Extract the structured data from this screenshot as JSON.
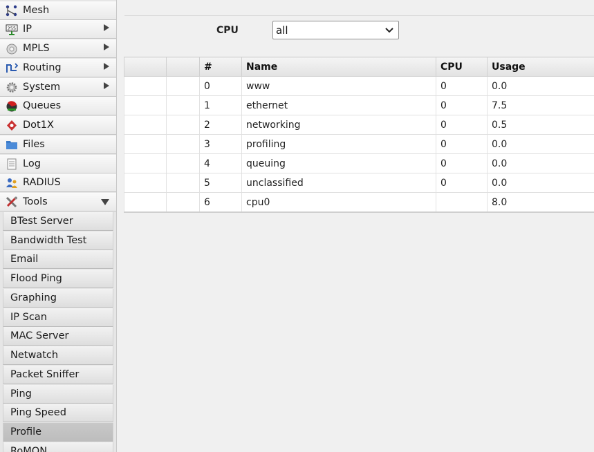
{
  "sidebar": {
    "items": [
      {
        "label": "Mesh",
        "icon": "mesh-icon",
        "has_submenu": false
      },
      {
        "label": "IP",
        "icon": "ip-icon",
        "has_submenu": true
      },
      {
        "label": "MPLS",
        "icon": "mpls-icon",
        "has_submenu": true
      },
      {
        "label": "Routing",
        "icon": "routing-icon",
        "has_submenu": true
      },
      {
        "label": "System",
        "icon": "gear-icon",
        "has_submenu": true
      },
      {
        "label": "Queues",
        "icon": "queues-icon",
        "has_submenu": false
      },
      {
        "label": "Dot1X",
        "icon": "dot1x-icon",
        "has_submenu": false
      },
      {
        "label": "Files",
        "icon": "folder-icon",
        "has_submenu": false
      },
      {
        "label": "Log",
        "icon": "log-icon",
        "has_submenu": false
      },
      {
        "label": "RADIUS",
        "icon": "users-icon",
        "has_submenu": false
      },
      {
        "label": "Tools",
        "icon": "tools-icon",
        "has_submenu": true,
        "expanded": true
      }
    ],
    "tools_submenu": [
      "BTest Server",
      "Bandwidth Test",
      "Email",
      "Flood Ping",
      "Graphing",
      "IP Scan",
      "MAC Server",
      "Netwatch",
      "Packet Sniffer",
      "Ping",
      "Ping Speed",
      "Profile",
      "RoMON"
    ],
    "active_submenu": "Profile"
  },
  "filter": {
    "label": "CPU",
    "selected": "all"
  },
  "table": {
    "columns": [
      "",
      "",
      "#",
      "Name",
      "CPU",
      "Usage"
    ],
    "rows": [
      [
        "0",
        "www",
        "0",
        "0.0"
      ],
      [
        "1",
        "ethernet",
        "0",
        "7.5"
      ],
      [
        "2",
        "networking",
        "0",
        "0.5"
      ],
      [
        "3",
        "profiling",
        "0",
        "0.0"
      ],
      [
        "4",
        "queuing",
        "0",
        "0.0"
      ],
      [
        "5",
        "unclassified",
        "0",
        "0.0"
      ],
      [
        "6",
        "cpu0",
        "",
        "8.0"
      ]
    ]
  },
  "colors": {
    "sidebar_bg": "#e6e6e6",
    "active_item": "#c2c2c2",
    "header_bg": "#e8e8e8"
  }
}
